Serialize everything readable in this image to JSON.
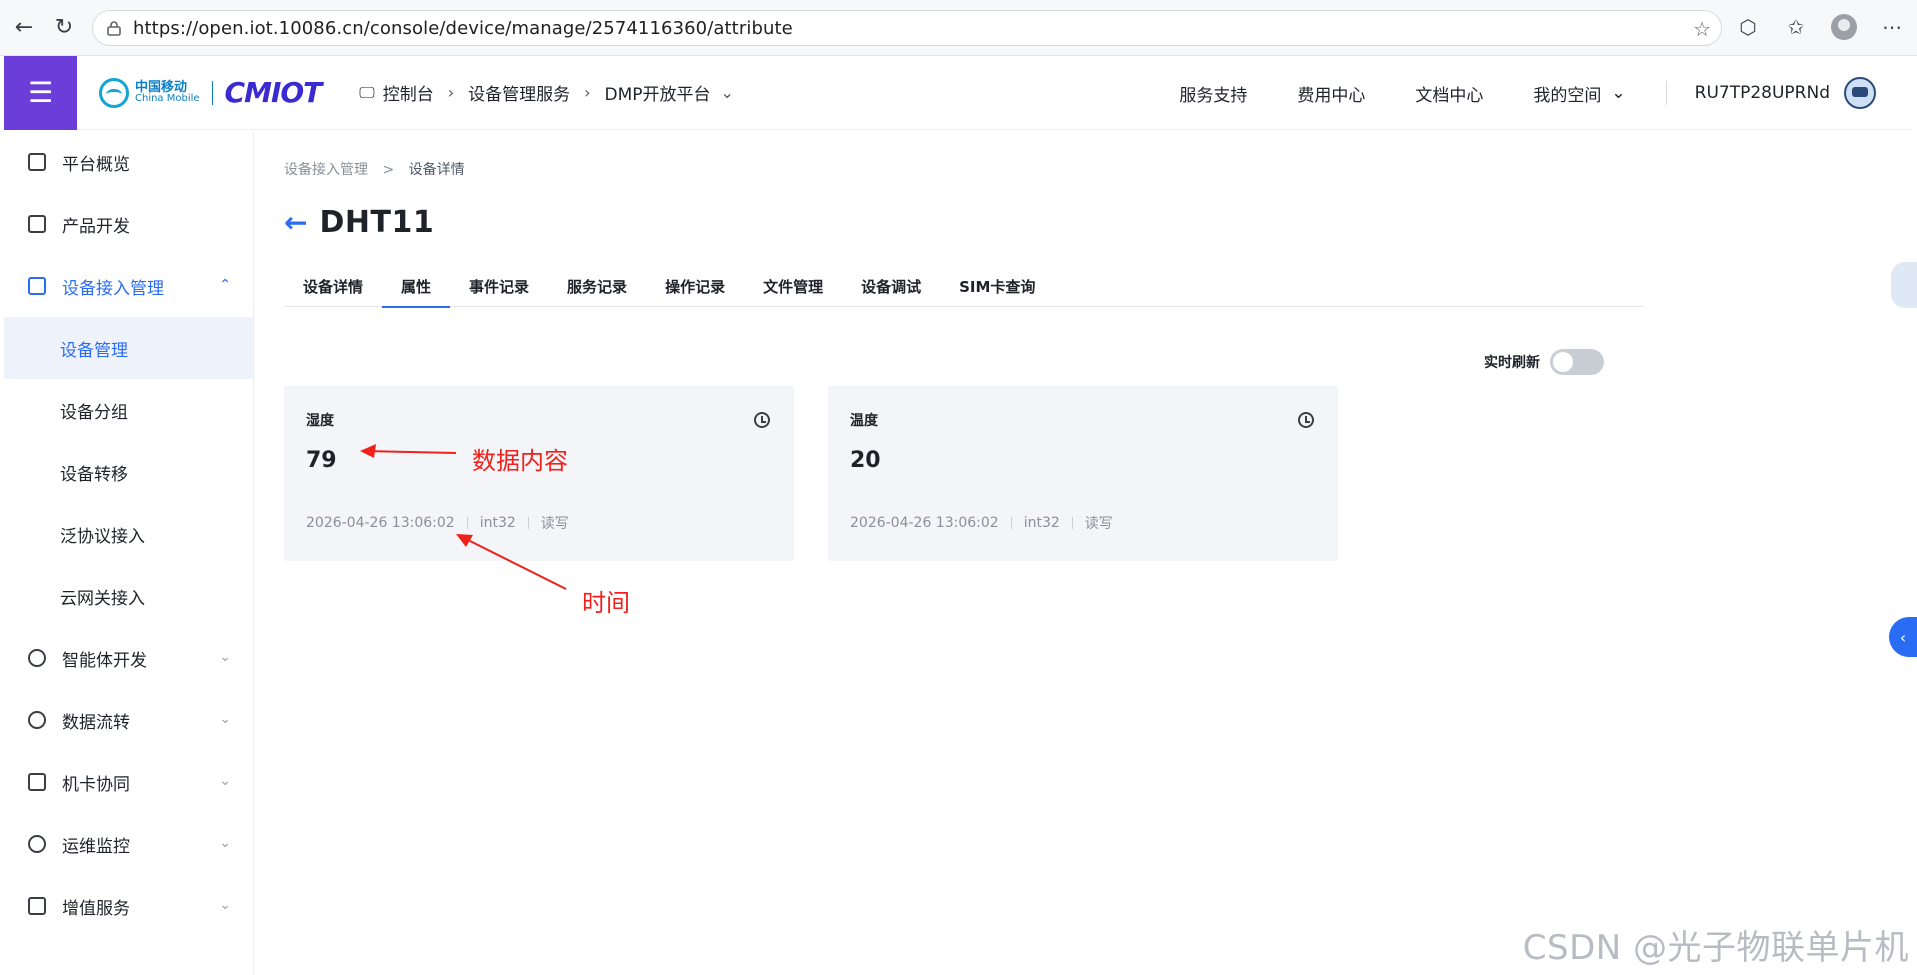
{
  "browser": {
    "url": "https://open.iot.10086.cn/console/device/manage/2574116360/attribute"
  },
  "header": {
    "brand_cn": "中国移动",
    "brand_en": "China Mobile",
    "brand_product": "CMIOT",
    "crumbs": [
      "控制台",
      "设备管理服务",
      "DMP开放平台"
    ],
    "links": [
      "服务支持",
      "费用中心",
      "文档中心",
      "我的空间"
    ],
    "username": "RU7TP28UPRNd"
  },
  "sidebar": {
    "items": [
      {
        "label": "平台概览",
        "icon": "chart-line-icon"
      },
      {
        "label": "产品开发",
        "icon": "cube-icon"
      },
      {
        "label": "设备接入管理",
        "icon": "device-access-icon"
      },
      {
        "label": "智能体开发",
        "icon": "ai-icon"
      },
      {
        "label": "数据流转",
        "icon": "data-flow-icon"
      },
      {
        "label": "机卡协同",
        "icon": "sim-card-icon"
      },
      {
        "label": "运维监控",
        "icon": "monitor-icon"
      },
      {
        "label": "增值服务",
        "icon": "value-added-icon"
      }
    ],
    "subitems": [
      "设备管理",
      "设备分组",
      "设备转移",
      "泛协议接入",
      "云网关接入"
    ]
  },
  "page": {
    "crumb_parent": "设备接入管理",
    "crumb_current": "设备详情",
    "title": "DHT11",
    "tabs": [
      "设备详情",
      "属性",
      "事件记录",
      "服务记录",
      "操作记录",
      "文件管理",
      "设备调试",
      "SIM卡查询"
    ],
    "active_tab": "属性",
    "realtime_label": "实时刷新",
    "realtime_on": false
  },
  "cards": [
    {
      "name": "湿度",
      "value": "79",
      "time": "2026-04-26 13:06:02",
      "type": "int32",
      "access": "读写"
    },
    {
      "name": "温度",
      "value": "20",
      "time": "2026-04-26 13:06:02",
      "type": "int32",
      "access": "读写"
    }
  ],
  "annotations": {
    "data_label": "数据内容",
    "time_label": "时间",
    "color": "#f0211b"
  },
  "watermark": "CSDN @光子物联单片机",
  "colors": {
    "accent": "#2a6df4",
    "menu_bg": "#6b3dd9",
    "brand_blue": "#0c80c6"
  }
}
